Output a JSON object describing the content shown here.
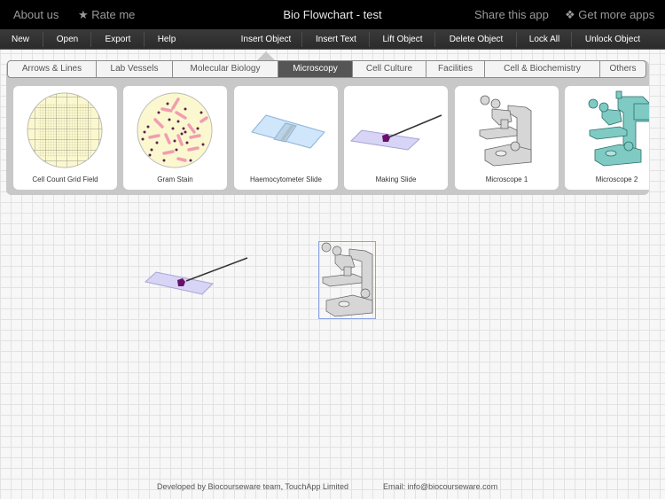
{
  "topbar": {
    "about": "About us",
    "rate": "★ Rate me",
    "title": "Bio Flowchart - test",
    "share": "Share this app",
    "more_icon": "❖",
    "more": "Get more apps"
  },
  "menu": [
    "New",
    "Open",
    "Export",
    "Help",
    "Insert Object",
    "Insert Text",
    "Lift Object",
    "Delete Object",
    "Lock All",
    "Unlock Object"
  ],
  "tabs": [
    "Arrows & Lines",
    "Lab Vessels",
    "Molecular Biology",
    "Microscopy",
    "Cell Culture",
    "Facilities",
    "Cell & Biochemistry",
    "Others"
  ],
  "active_tab": "Microscopy",
  "cards": [
    "Cell Count Grid Field",
    "Gram Stain",
    "Haemocytometer Slide",
    "Making Slide",
    "Microscope 1",
    "Microscope 2"
  ],
  "canvas_objects": [
    "Making Slide",
    "Microscope 1"
  ],
  "selected_object": "Microscope 1",
  "footer": {
    "developer": "Developed by Biocourseware team, TouchApp Limited",
    "email": "Email: info@biocourseware.com"
  },
  "colors": {
    "topbar": "#000000",
    "menubar": "#333333",
    "active_tab": "#555555",
    "microscope2": "#7fcbc4",
    "selection": "#8aa3e0"
  }
}
